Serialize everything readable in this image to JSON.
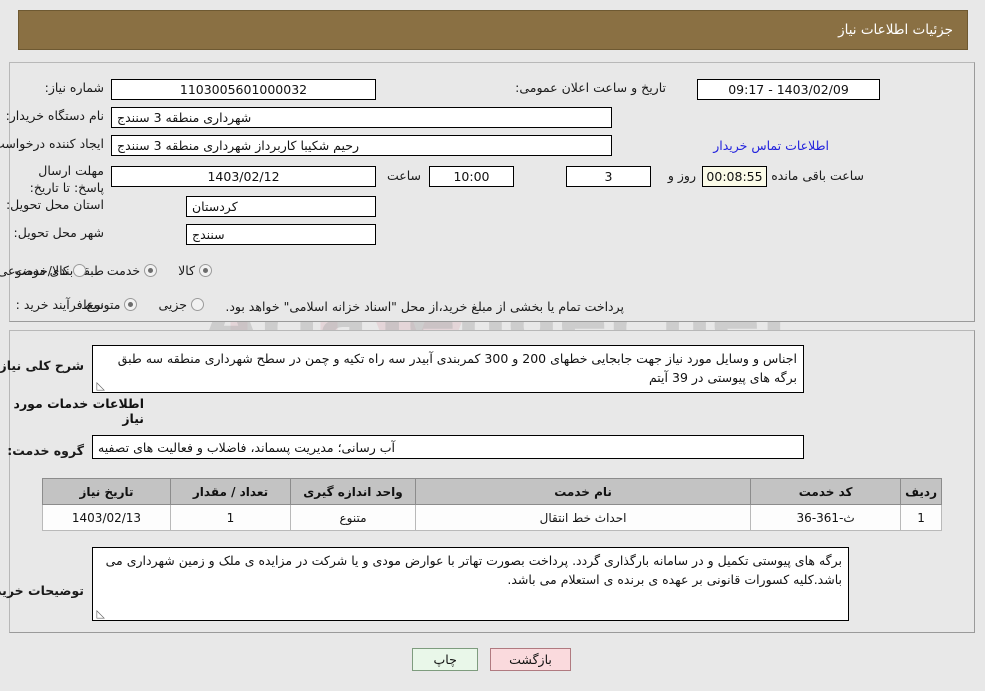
{
  "header": {
    "title": "جزئیات اطلاعات نیاز"
  },
  "form": {
    "need_number_label": "شماره نیاز:",
    "need_number_value": "1103005601000032",
    "announce_label": "تاریخ و ساعت اعلان عمومی:",
    "announce_value": "1403/02/09 - 09:17",
    "buyer_org_label": "نام دستگاه خریدار:",
    "buyer_org_value": "شهرداری منطقه 3 سنندج",
    "creator_label": "ایجاد کننده درخواست:",
    "creator_value": "رحیم شکیبا کاربرداز شهرداری منطقه 3 سنندج",
    "contact_link": "اطلاعات تماس خریدار",
    "deadline_label": "مهلت ارسال پاسخ: تا تاریخ:",
    "deadline_date": "1403/02/12",
    "hour_label": "ساعت",
    "deadline_time": "10:00",
    "days_value": "3",
    "days_label": "روز و",
    "countdown_value": "00:08:55",
    "countdown_label": "ساعت باقی مانده",
    "province_label": "استان محل تحویل:",
    "province_value": "کردستان",
    "city_label": "شهر محل تحویل:",
    "city_value": "سنندج",
    "category_label": "طبقه بندی موضوعی:",
    "category_options": [
      {
        "label": "کالا",
        "selected": false
      },
      {
        "label": "خدمت",
        "selected": true
      },
      {
        "label": "کالا/خدمت",
        "selected": false
      }
    ],
    "process_label": "نوع فرآیند خرید :",
    "process_options": [
      {
        "label": "جزیی",
        "selected": false
      },
      {
        "label": "متوسط",
        "selected": true
      }
    ],
    "payment_note": "پرداخت تمام یا بخشی از مبلغ خرید،از محل \"اسناد خزانه اسلامی\" خواهد بود."
  },
  "description": {
    "label": "شرح کلی نیاز:",
    "value": "اجناس و وسایل مورد نیاز جهت جابجایی خطهای 200 و 300 کمربندی آبیدر سه راه تکیه و چمن در سطح شهرداری منطقه سه طبق برگه های پیوستی در 39 آیتم"
  },
  "services_section": {
    "heading": "اطلاعات خدمات مورد نیاز",
    "group_label": "گروه خدمت:",
    "group_value": "آب رسانی؛ مدیریت پسماند، فاضلاب و فعالیت های تصفیه"
  },
  "table": {
    "headers": [
      "ردیف",
      "کد خدمت",
      "نام خدمت",
      "واحد اندازه گیری",
      "تعداد / مقدار",
      "تاریخ نیاز"
    ],
    "rows": [
      {
        "row_no": "1",
        "service_code": "ث-361-36",
        "service_name": "احداث خط انتقال",
        "unit": "متنوع",
        "quantity": "1",
        "need_date": "1403/02/13"
      }
    ]
  },
  "buyer_notes": {
    "label": "توضیحات خریدار:",
    "value": "برگه های پیوستی تکمیل و در سامانه بارگذاری گردد. پرداخت بصورت تهاتر با عوارض مودی و یا شرکت در مزایده ی ملک و زمین شهرداری می باشد.کلیه کسورات قانونی بر عهده ی برنده ی استعلام می باشد."
  },
  "buttons": {
    "print": "چاپ",
    "back": "بازگشت"
  },
  "watermark": {
    "text": "AriaTender.net"
  },
  "colors": {
    "header_bg": "#8a7043",
    "link": "#2222dd",
    "print_btn": "#e9f7e9",
    "back_btn": "#fadadd",
    "countdown_bg": "#fbfbe8",
    "table_header_bg": "#c3c3c3"
  }
}
